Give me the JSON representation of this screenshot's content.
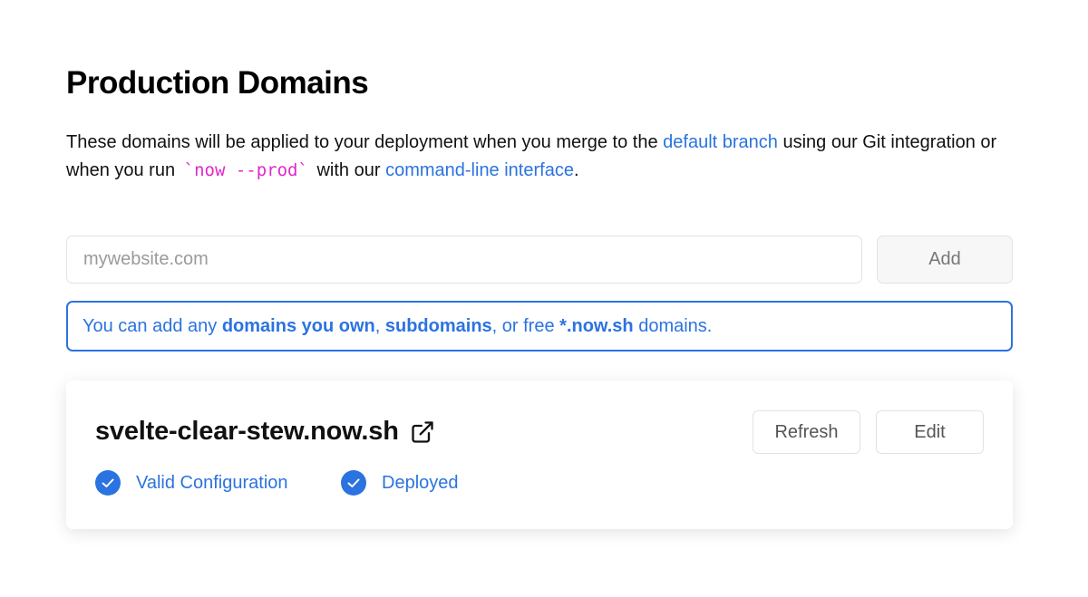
{
  "header": {
    "title": "Production Domains"
  },
  "description": {
    "part1": "These domains will be applied to your deployment when you merge to the ",
    "link_default_branch": "default branch",
    "part2": " using our Git integration or when you run ",
    "command": "`now --prod`",
    "part3": " with our ",
    "link_cli": "command-line interface",
    "part4": "."
  },
  "add_form": {
    "input_placeholder": "mywebsite.com",
    "input_value": "",
    "add_label": "Add"
  },
  "info_note": {
    "t1": "You can add any ",
    "b1": "domains you own",
    "t2": ", ",
    "b2": "subdomains",
    "t3": ", or free ",
    "b3": "*.now.sh",
    "t4": " domains."
  },
  "domain_card": {
    "domain": "svelte-clear-stew.now.sh",
    "refresh_label": "Refresh",
    "edit_label": "Edit",
    "statuses": [
      {
        "label": "Valid Configuration",
        "icon": "check-circle-icon"
      },
      {
        "label": "Deployed",
        "icon": "check-circle-icon"
      }
    ]
  },
  "colors": {
    "accent": "#2b73e0",
    "command": "#e028c8",
    "border": "#e2e2e2"
  }
}
